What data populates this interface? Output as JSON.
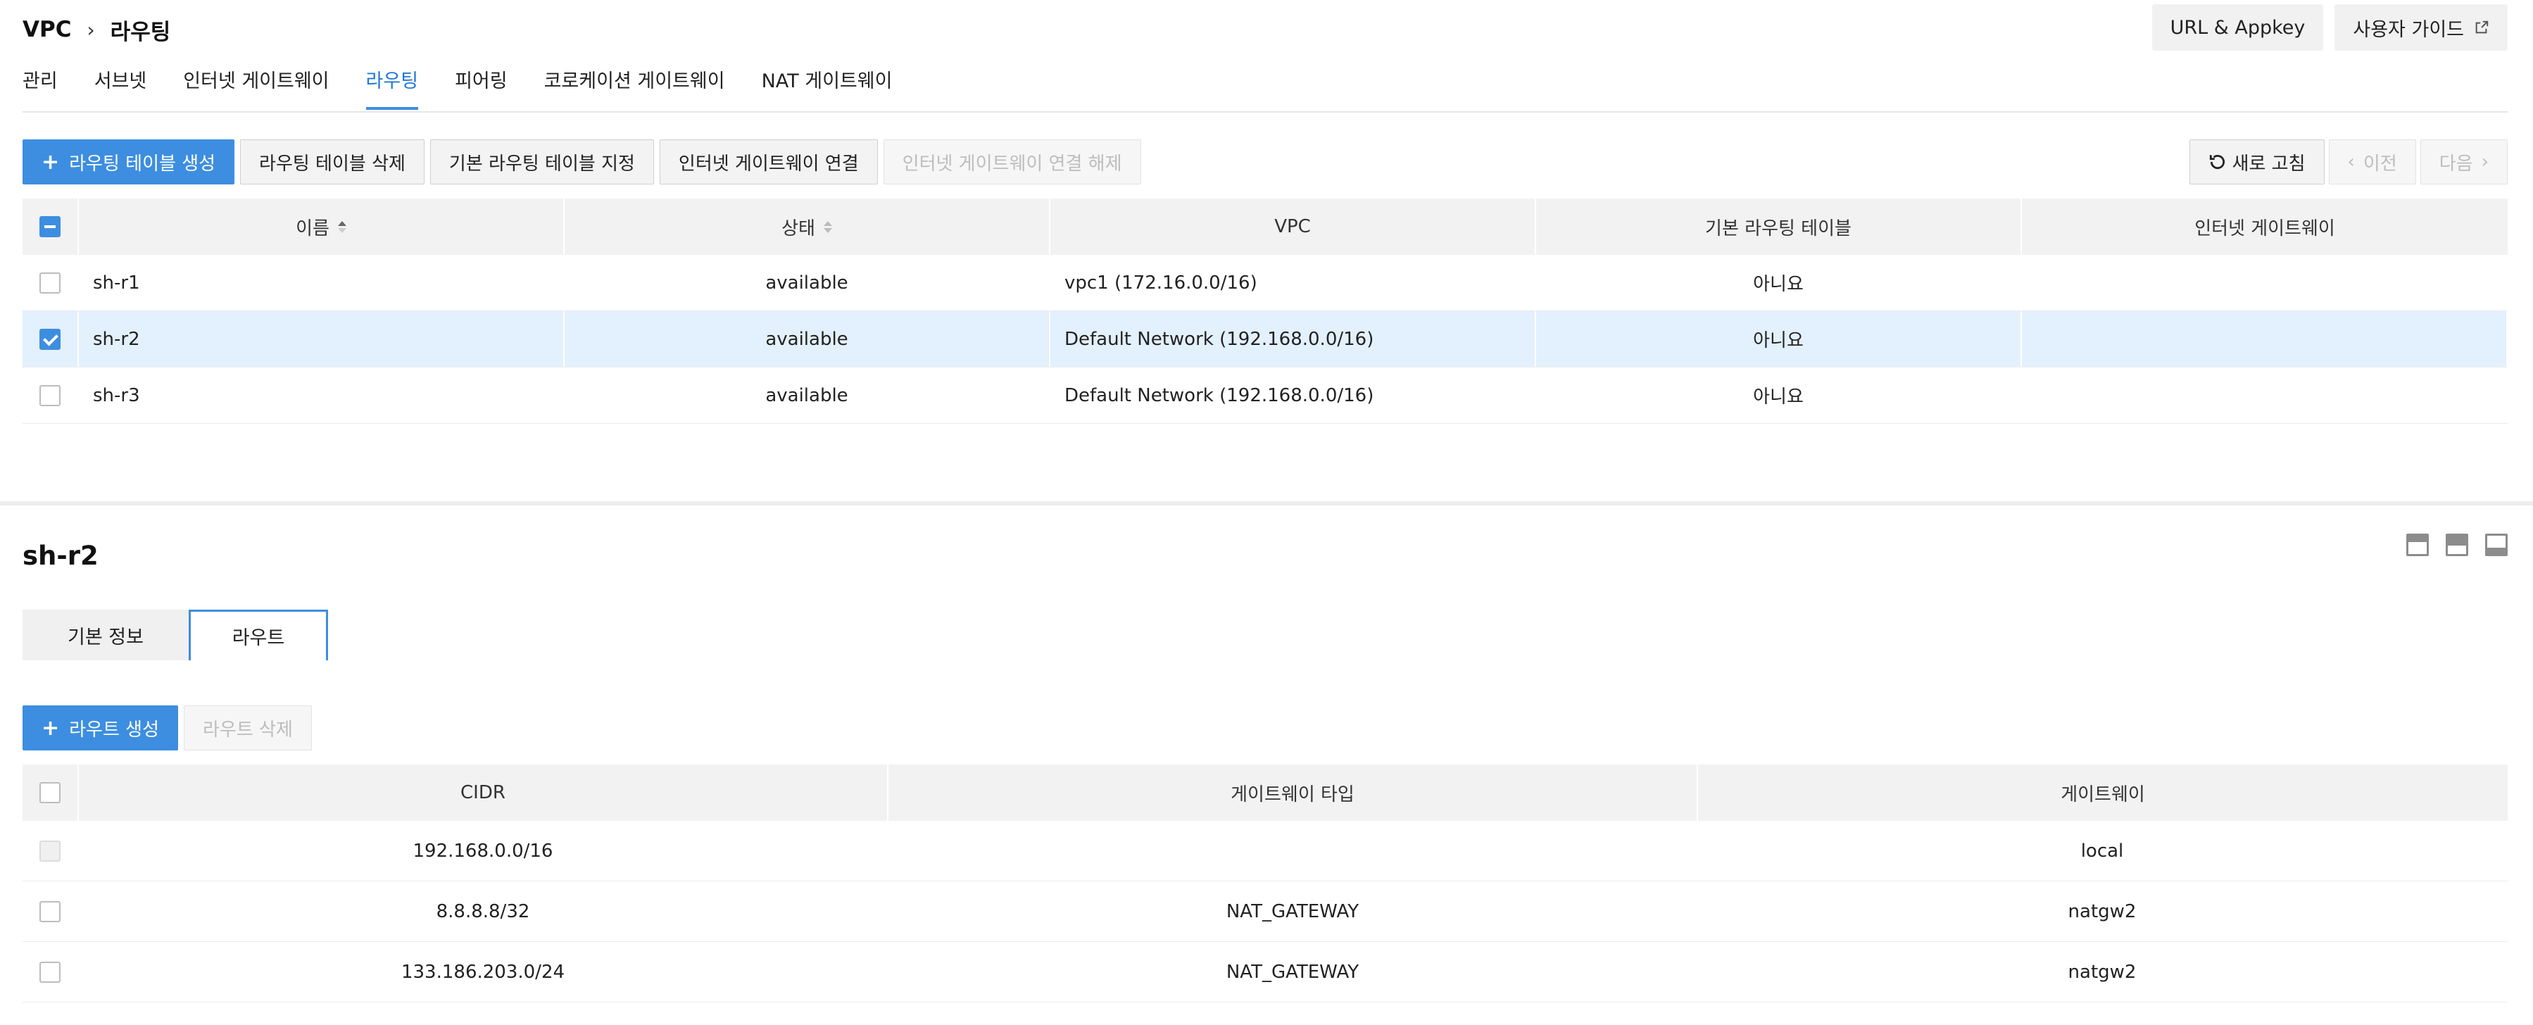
{
  "breadcrumb": {
    "root": "VPC",
    "current": "라우팅"
  },
  "header_buttons": {
    "url_appkey": "URL & Appkey",
    "user_guide": "사용자 가이드"
  },
  "tabs": [
    {
      "label": "관리",
      "active": false
    },
    {
      "label": "서브넷",
      "active": false
    },
    {
      "label": "인터넷 게이트웨이",
      "active": false
    },
    {
      "label": "라우팅",
      "active": true
    },
    {
      "label": "피어링",
      "active": false
    },
    {
      "label": "코로케이션 게이트웨이",
      "active": false
    },
    {
      "label": "NAT 게이트웨이",
      "active": false
    }
  ],
  "toolbar": {
    "create": "라우팅 테이블 생성",
    "delete": "라우팅 테이블 삭제",
    "set_default": "기본 라우팅 테이블 지정",
    "attach_igw": "인터넷 게이트웨이 연결",
    "detach_igw": "인터넷 게이트웨이 연결 해제",
    "refresh": "새로 고침",
    "prev": "이전",
    "next": "다음"
  },
  "routing_table": {
    "columns": [
      "이름",
      "상태",
      "VPC",
      "기본 라우팅 테이블",
      "인터넷 게이트웨이"
    ],
    "rows": [
      {
        "name": "sh-r1",
        "status": "available",
        "vpc": "vpc1 (172.16.0.0/16)",
        "default": "아니요",
        "igw": "",
        "checked": false
      },
      {
        "name": "sh-r2",
        "status": "available",
        "vpc": "Default Network (192.168.0.0/16)",
        "default": "아니요",
        "igw": "",
        "checked": true
      },
      {
        "name": "sh-r3",
        "status": "available",
        "vpc": "Default Network (192.168.0.0/16)",
        "default": "아니요",
        "igw": "",
        "checked": false
      }
    ]
  },
  "detail": {
    "title": "sh-r2",
    "tabs": [
      {
        "label": "기본 정보",
        "active": false
      },
      {
        "label": "라우트",
        "active": true
      }
    ],
    "route_toolbar": {
      "create": "라우트 생성",
      "delete": "라우트 삭제"
    },
    "route_table": {
      "columns": [
        "CIDR",
        "게이트웨이 타입",
        "게이트웨이"
      ],
      "rows": [
        {
          "cidr": "192.168.0.0/16",
          "type": "",
          "gateway": "local",
          "disabled": true
        },
        {
          "cidr": "8.8.8.8/32",
          "type": "NAT_GATEWAY",
          "gateway": "natgw2",
          "disabled": false
        },
        {
          "cidr": "133.186.203.0/24",
          "type": "NAT_GATEWAY",
          "gateway": "natgw2",
          "disabled": false
        }
      ]
    }
  },
  "colors": {
    "accent": "#3d8ee0",
    "selected_row": "#e3f0fd",
    "header_bg": "#f2f2f2"
  }
}
